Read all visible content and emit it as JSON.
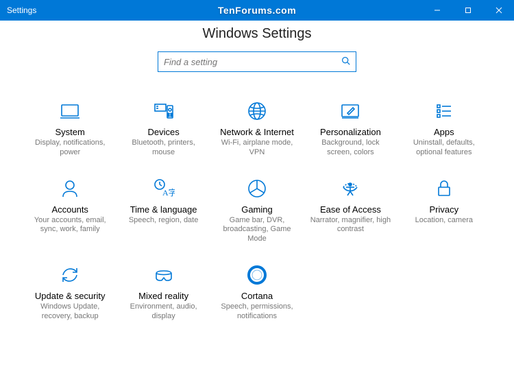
{
  "window": {
    "title": "Settings",
    "watermark": "TenForums.com"
  },
  "header": {
    "page_title": "Windows Settings",
    "search_placeholder": "Find a setting"
  },
  "tiles": [
    {
      "id": "system",
      "title": "System",
      "desc": "Display, notifications, power"
    },
    {
      "id": "devices",
      "title": "Devices",
      "desc": "Bluetooth, printers, mouse"
    },
    {
      "id": "network",
      "title": "Network & Internet",
      "desc": "Wi-Fi, airplane mode, VPN"
    },
    {
      "id": "personalization",
      "title": "Personalization",
      "desc": "Background, lock screen, colors"
    },
    {
      "id": "apps",
      "title": "Apps",
      "desc": "Uninstall, defaults, optional features"
    },
    {
      "id": "accounts",
      "title": "Accounts",
      "desc": "Your accounts, email, sync, work, family"
    },
    {
      "id": "time-language",
      "title": "Time & language",
      "desc": "Speech, region, date"
    },
    {
      "id": "gaming",
      "title": "Gaming",
      "desc": "Game bar, DVR, broadcasting, Game Mode"
    },
    {
      "id": "ease-of-access",
      "title": "Ease of Access",
      "desc": "Narrator, magnifier, high contrast"
    },
    {
      "id": "privacy",
      "title": "Privacy",
      "desc": "Location, camera"
    },
    {
      "id": "update-security",
      "title": "Update & security",
      "desc": "Windows Update, recovery, backup"
    },
    {
      "id": "mixed-reality",
      "title": "Mixed reality",
      "desc": "Environment, audio, display"
    },
    {
      "id": "cortana",
      "title": "Cortana",
      "desc": "Speech, permissions, notifications"
    }
  ]
}
